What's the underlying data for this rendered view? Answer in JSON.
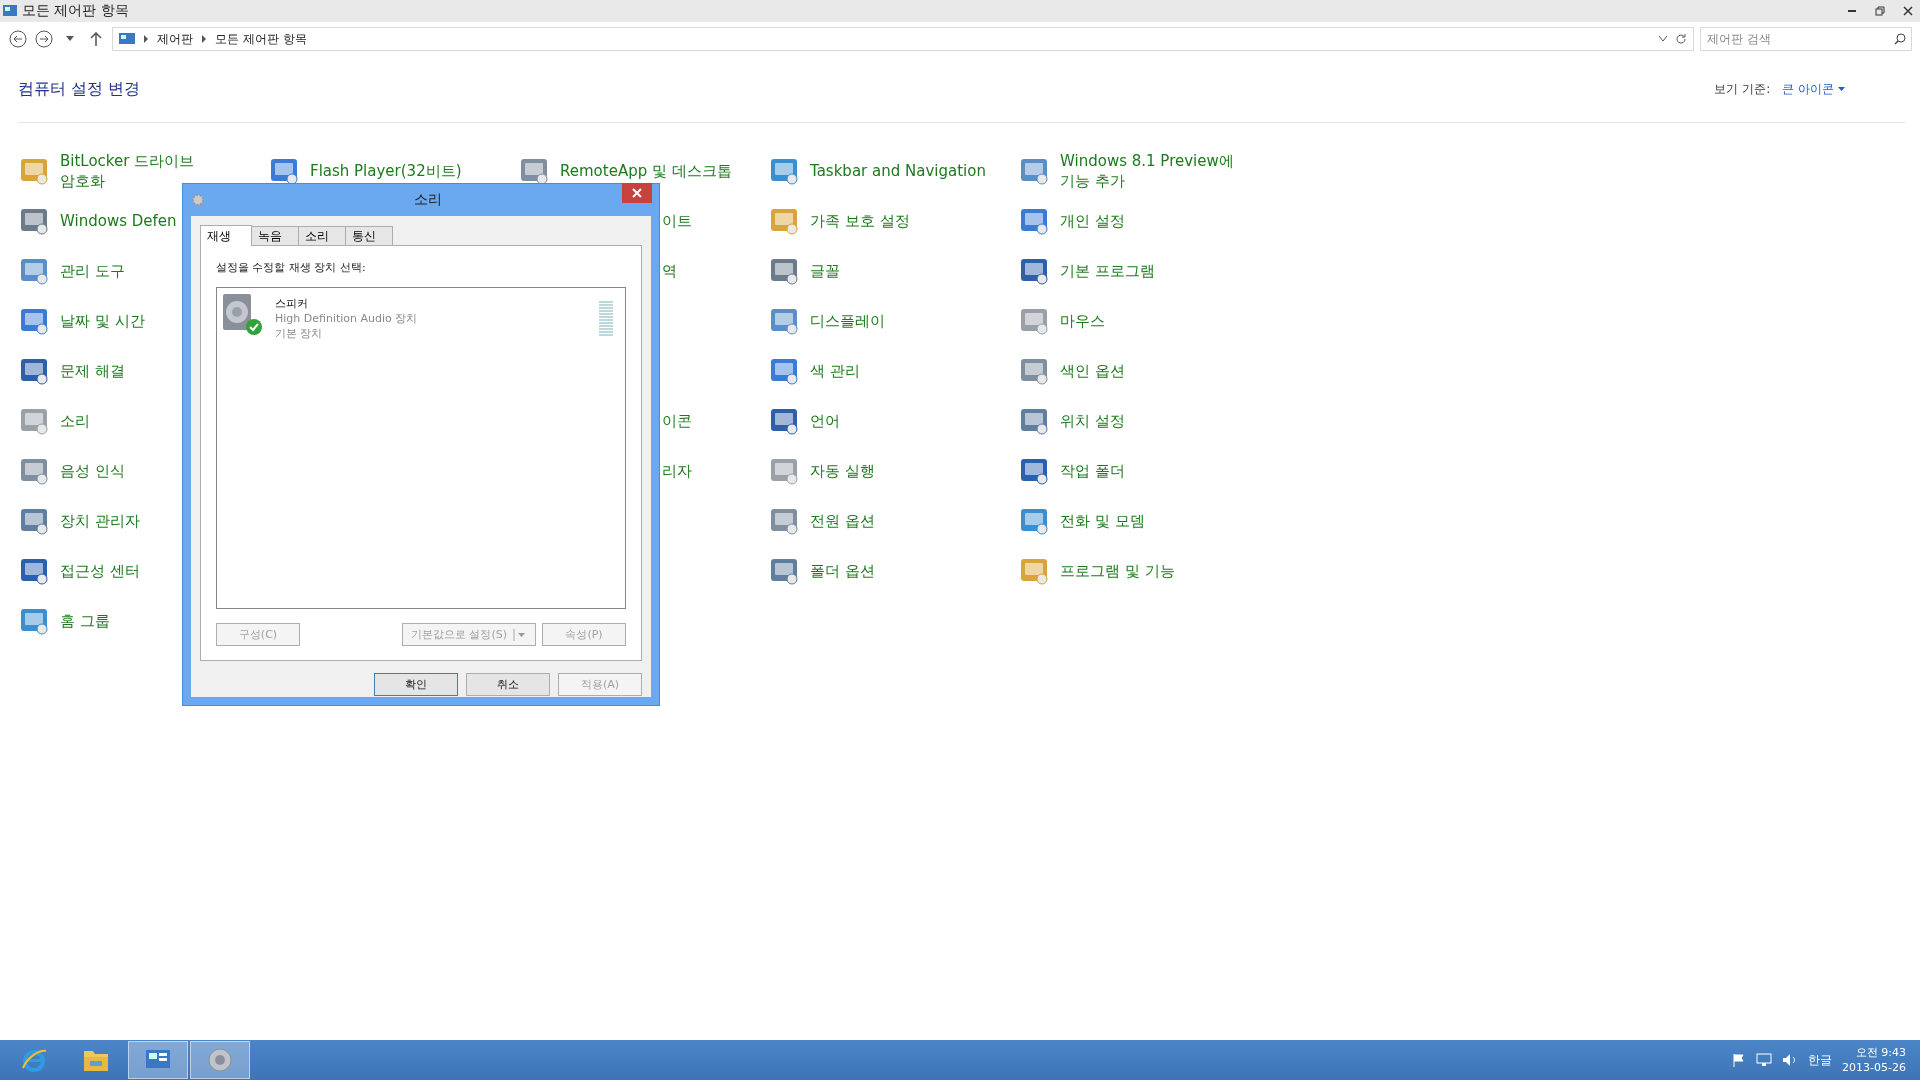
{
  "window": {
    "title": "모든 제어판 항목"
  },
  "address_bar": {
    "breadcrumb": [
      "제어판",
      "모든 제어판 항목"
    ]
  },
  "search": {
    "placeholder": "제어판 검색"
  },
  "header": {
    "title": "컴퓨터 설정 변경",
    "view_by_label": "보기 기준:",
    "view_by_value": "큰 아이콘"
  },
  "columns": [
    {
      "items": [
        {
          "kind": "applet",
          "label": "BitLocker 드라이브 암호화"
        },
        {
          "kind": "applet",
          "label": "Windows Defen"
        },
        {
          "kind": "applet",
          "label": "관리 도구"
        },
        {
          "kind": "applet",
          "label": "날짜 및 시간"
        },
        {
          "kind": "applet",
          "label": "문제 해결"
        },
        {
          "kind": "applet",
          "label": "소리"
        },
        {
          "kind": "applet",
          "label": "음성 인식"
        },
        {
          "kind": "applet",
          "label": "장치 관리자"
        },
        {
          "kind": "applet",
          "label": "접근성 센터"
        },
        {
          "kind": "applet",
          "label": "홈 그룹"
        }
      ]
    },
    {
      "items": [
        {
          "kind": "applet",
          "label": "Flash Player(32비트)"
        }
      ]
    },
    {
      "items": [
        {
          "kind": "applet",
          "label": "RemoteApp 및 데스크톱"
        },
        {
          "kind": "fragment",
          "label": "이트"
        },
        {
          "kind": "fragment",
          "label": "역"
        },
        {
          "kind": "hidden"
        },
        {
          "kind": "hidden"
        },
        {
          "kind": "fragment",
          "label": "이콘"
        },
        {
          "kind": "fragment",
          "label": "리자"
        }
      ]
    },
    {
      "items": [
        {
          "kind": "applet",
          "label": "Taskbar and Navigation"
        },
        {
          "kind": "applet",
          "label": "가족 보호 설정"
        },
        {
          "kind": "applet",
          "label": "글꼴"
        },
        {
          "kind": "applet",
          "label": "디스플레이"
        },
        {
          "kind": "applet",
          "label": "색 관리"
        },
        {
          "kind": "applet",
          "label": "언어"
        },
        {
          "kind": "applet",
          "label": "자동 실행"
        },
        {
          "kind": "applet",
          "label": "전원 옵션"
        },
        {
          "kind": "applet",
          "label": "폴더 옵션"
        }
      ]
    },
    {
      "items": [
        {
          "kind": "applet",
          "label": "Windows 8.1 Preview에 기능 추가"
        },
        {
          "kind": "applet",
          "label": "개인 설정"
        },
        {
          "kind": "applet",
          "label": "기본 프로그램"
        },
        {
          "kind": "applet",
          "label": "마우스"
        },
        {
          "kind": "applet",
          "label": "색인 옵션"
        },
        {
          "kind": "applet",
          "label": "위치 설정"
        },
        {
          "kind": "applet",
          "label": "작업 폴더"
        },
        {
          "kind": "applet",
          "label": "전화 및 모뎀"
        },
        {
          "kind": "applet",
          "label": "프로그램 및 기능"
        }
      ]
    }
  ],
  "dialog": {
    "title": "소리",
    "tabs": [
      {
        "label": "재생",
        "selected": true
      },
      {
        "label": "녹음",
        "selected": false
      },
      {
        "label": "소리",
        "selected": false
      },
      {
        "label": "통신",
        "selected": false
      }
    ],
    "instruction": "설정을 수정할 재생 장치 선택:",
    "devices": [
      {
        "name": "스피커",
        "description": "High Definition Audio 장치",
        "status": "기본 장치",
        "default": true
      }
    ],
    "buttons": [
      {
        "kind": "plain",
        "label": "구성(C)",
        "disabled": true
      },
      {
        "kind": "split",
        "label": "기본값으로 설정(S)",
        "disabled": true
      },
      {
        "kind": "plain",
        "label": "속성(P)",
        "disabled": true
      }
    ],
    "footer_buttons": [
      {
        "label": "확인",
        "disabled": false,
        "default": true
      },
      {
        "label": "취소",
        "disabled": false,
        "default": false
      },
      {
        "label": "적용(A)",
        "disabled": true,
        "default": false
      }
    ]
  },
  "taskbar": {
    "apps": [
      {
        "selected": false
      },
      {
        "selected": false
      },
      {
        "selected": true
      },
      {
        "selected": true
      }
    ],
    "tray": {
      "ime": "한글",
      "time": "오전 9:43",
      "date": "2013-05-26"
    }
  }
}
